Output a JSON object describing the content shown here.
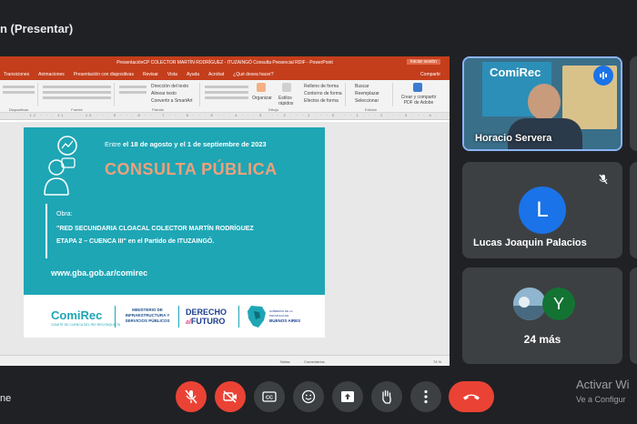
{
  "meet": {
    "presenting_title": "n (Presentar)",
    "meeting_label": "ne",
    "activate_line1": "Activar Wi",
    "activate_line2": "Ve a Configur",
    "colors": {
      "background": "#202124",
      "tile": "#3c4043",
      "danger": "#ea4335",
      "active_speaker_border": "#8ab4f8"
    }
  },
  "powerpoint": {
    "window_title": "PresentaciónCP COLECTOR MARTÍN RODRÍGUEZ - ITUZAINGÓ Consulta Presencial RDIF - PowerPoint",
    "signin_label": "Iniciar sesión",
    "tabs": [
      "Transiciones",
      "Animaciones",
      "Presentación con diapositivas",
      "Revisar",
      "Vista",
      "Ayuda",
      "Acrobat",
      "¿Qué desea hacer?"
    ],
    "share_label": "Compartir",
    "ribbon": {
      "slides_group": "Diapositivas",
      "font_group": "Fuente",
      "paragraph_group": "Párrafo",
      "drawing_group": "Dibujo",
      "editing_group": "Edición",
      "buscar": "Buscar",
      "reemplazar": "Reemplazar",
      "seleccionar": "Seleccionar",
      "organizar": "Organizar",
      "estilos": "Estilos rápidos",
      "relleno": "Relleno de forma",
      "contorno": "Contorno de forma",
      "efectos": "Efectos de forma",
      "direccion": "Dirección del texto",
      "alinear": "Alinear texto",
      "smartart": "Convertir a SmartArt",
      "adobe": "Crear y compartir PDF de Adobe"
    },
    "ruler_text": "· 12 · · · 11 · · · 10 · · · 9 · · · 8 · · · 7 · · · 6 · · · 5 · · · 4 · · · 3 · · · 2 · · · 1 · · · 0 · · · 1 · · · 2 · · · 3 · · · 4 · · · 5 · · · 6 · · · 7 · · · 8 · · · 9 · · · 10 · · · 11 · · · 12",
    "status": {
      "notes": "Notas",
      "comments": "Comentarios",
      "zoom": "74 %"
    }
  },
  "slide": {
    "date_prefix": "Entre ",
    "date_bold": "el 18 de agosto y el 1 de septiembre de 2023",
    "heading": "CONSULTA PÚBLICA",
    "obra_label": "Obra:",
    "obra_line1": "\"RED SECUNDARIA CLOACAL COLECTOR MARTÍN RODRÍGUEZ",
    "obra_line2_bold": "ETAPA 2 – CUENCA III\"",
    "obra_line2_rest": " en el Partido de ITUZAINGÓ.",
    "url": "www.gba.gob.ar/comirec",
    "logo_comirec": "ComiRec",
    "logo_comirec_sub": "COMITÉ DE CUENCA DEL RÍO RECONQUISTA",
    "logo_ministerio": "MINISTERIO DE INFRAESTRUCTURA Y SERVICIOS PÚBLICOS",
    "logo_derecho_1": "DERECHO",
    "logo_derecho_al": "al",
    "logo_derecho_2": "FUTURO",
    "logo_ba_small": "GOBIERNO DE LA PROVINCIA DE",
    "logo_ba": "BUENOS AIRES"
  },
  "participants": [
    {
      "name": "Horacio Servera",
      "speaking": true,
      "video_banner": "ComiRec"
    },
    {
      "name": "Lucas Joaquin Palacios",
      "initial": "L",
      "avatar_color": "#1a73e8",
      "muted": true
    },
    {
      "name": "24 más",
      "initial": "Y",
      "avatar_color": "#137333"
    }
  ],
  "controls": {
    "mic": "microphone-off",
    "camera": "camera-off",
    "captions": "CC",
    "emoji": "emoji",
    "present": "present-now",
    "raise_hand": "raise-hand",
    "more": "more-options",
    "end_call": "end-call"
  }
}
